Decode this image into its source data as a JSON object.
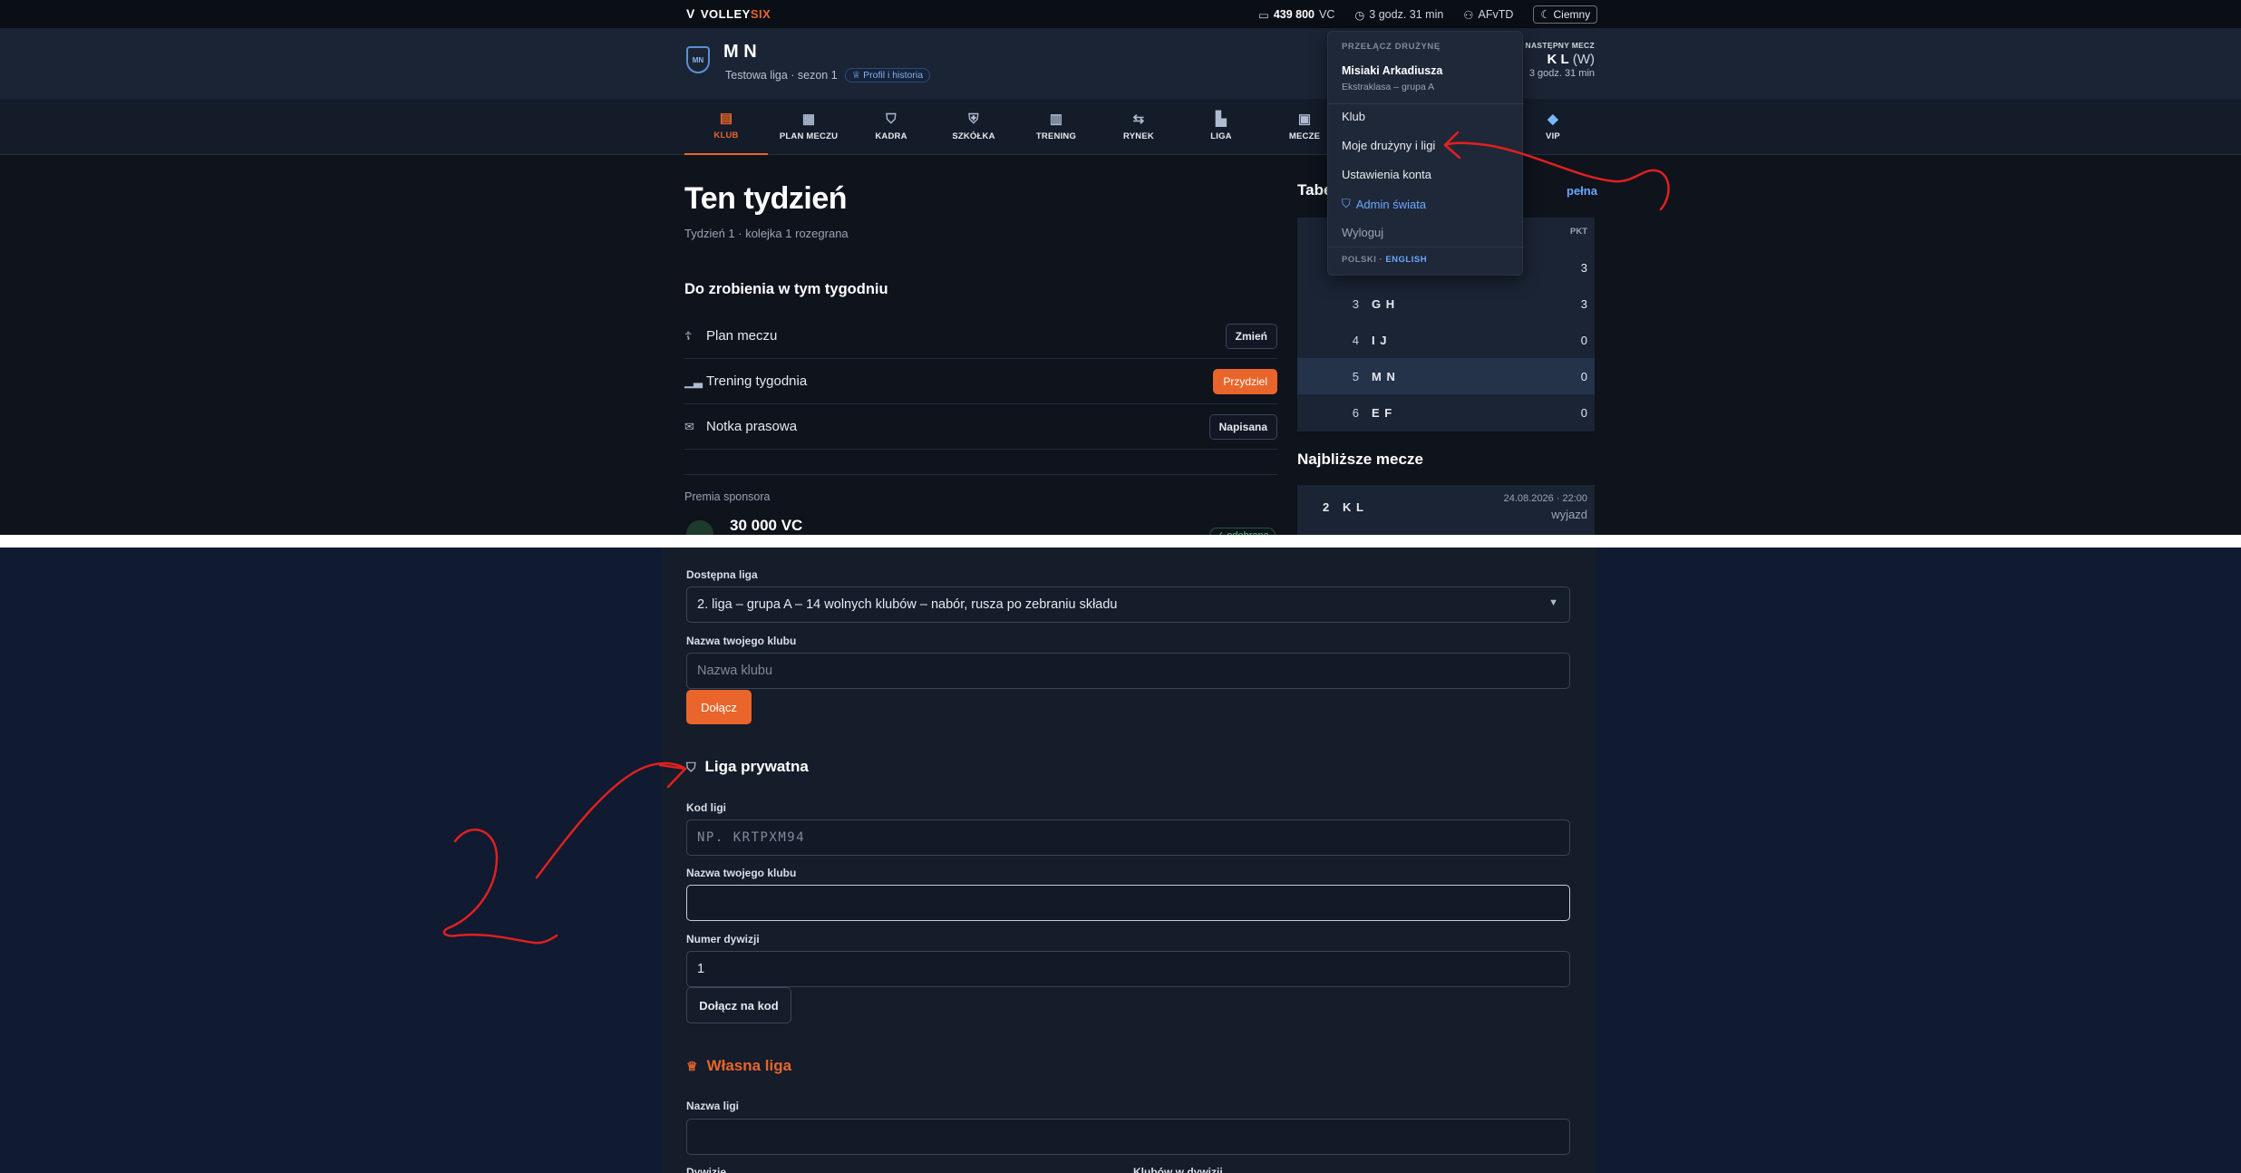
{
  "topbar": {
    "logo_left": "VOLLEY",
    "logo_right": "SIX",
    "coins_value": "439 800",
    "coins_unit": "VC",
    "timer": "3 godz. 31 min",
    "username": "AFvTD",
    "theme_toggle": "Ciemny"
  },
  "team": {
    "crest": "MN",
    "name": "M N",
    "subtitle": "Testowa liga · sezon 1",
    "history_pill": "Profil i historia"
  },
  "next_match": {
    "label": "NASTĘPNY MECZ",
    "team": "K L",
    "venue": "(W)",
    "time": "3 godz. 31 min"
  },
  "nav": [
    {
      "label": "KLUB",
      "icon": "club-icon"
    },
    {
      "label": "PLAN MECZU",
      "icon": "tactics-icon"
    },
    {
      "label": "KADRA",
      "icon": "shirt-icon"
    },
    {
      "label": "SZKÓŁKA",
      "icon": "academy-icon"
    },
    {
      "label": "TRENING",
      "icon": "training-icon"
    },
    {
      "label": "RYNEK",
      "icon": "market-icon"
    },
    {
      "label": "LIGA",
      "icon": "league-icon"
    },
    {
      "label": "MECZE",
      "icon": "calendar-icon"
    },
    {
      "label": "VIP",
      "icon": "diamond-icon"
    }
  ],
  "week": {
    "title": "Ten tydzień",
    "subtitle": "Tydzień 1 · kolejka 1 rozegrana",
    "todo_title": "Do zrobienia w tym tygodniu",
    "todos": [
      {
        "label": "Plan meczu",
        "action": "Zmień"
      },
      {
        "label": "Trening tygodnia",
        "action": "Przydziel"
      },
      {
        "label": "Notka prasowa",
        "action": "Napisana"
      }
    ],
    "sponsor_label": "Premia sponsora",
    "sponsor_value": "30 000 VC",
    "sponsor_badge": "✓ odebrana"
  },
  "standings": {
    "title": "Tabe",
    "full_link": "pełna",
    "pts_header": "PKT",
    "rows": [
      {
        "pos": "",
        "team": "",
        "pts": "3"
      },
      {
        "pos": "3",
        "team": "G H",
        "pts": "3"
      },
      {
        "pos": "4",
        "team": "I J",
        "pts": "0"
      },
      {
        "pos": "5",
        "team": "M N",
        "pts": "0"
      },
      {
        "pos": "6",
        "team": "E F",
        "pts": "0"
      }
    ]
  },
  "upcoming": {
    "title": "Najbliższe mecze",
    "match": {
      "num": "2",
      "team": "K L",
      "datetime": "24.08.2026 · 22:00",
      "location": "wyjazd"
    }
  },
  "dropdown": {
    "header": "PRZEŁĄCZ DRUŻYNĘ",
    "team": "Misiaki Arkadiusza",
    "league": "Ekstraklasa – grupa A",
    "items": [
      "Klub",
      "Moje drużyny i ligi",
      "Ustawienia konta",
      "Admin świata",
      "Wyloguj"
    ],
    "lang_current": "POLSKI",
    "lang_sep": " · ",
    "lang_other": "ENGLISH"
  },
  "join_form": {
    "league_label": "Dostępna liga",
    "league_value": "2. liga – grupa A – 14 wolnych klubów – nabór, rusza po zebraniu składu",
    "club_label": "Nazwa twojego klubu",
    "club_placeholder": "Nazwa klubu",
    "join_button": "Dołącz"
  },
  "private_league": {
    "title": "Liga prywatna",
    "code_label": "Kod ligi",
    "code_placeholder": "NP. KRTPXM94",
    "club_label": "Nazwa twojego klubu",
    "division_label": "Numer dywizji",
    "division_value": "1",
    "join_code_button": "Dołącz na kod"
  },
  "own_league": {
    "title": "Własna liga",
    "name_label": "Nazwa ligi",
    "cut_label_left": "Dywizje",
    "cut_label_right": "Klubów w dywizji"
  },
  "colors": {
    "accent": "#e9652b",
    "link": "#6aa8ff",
    "annotation": "#e02020"
  }
}
